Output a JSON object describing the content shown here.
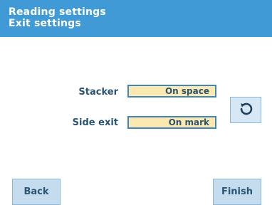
{
  "header": {
    "title": "Reading settings",
    "subtitle": "Exit settings"
  },
  "settings": [
    {
      "label": "Stacker",
      "value": "On space"
    },
    {
      "label": "Side exit",
      "value": "On mark"
    }
  ],
  "icons": {
    "reset": "reset-icon"
  },
  "footer": {
    "back_label": "Back",
    "finish_label": "Finish"
  },
  "colors": {
    "header_bg": "#3f9ad6",
    "value_bg": "#fce9b1",
    "value_border": "#3f86bd",
    "button_bg": "#c5dcef",
    "text_dark": "#2a5474"
  }
}
